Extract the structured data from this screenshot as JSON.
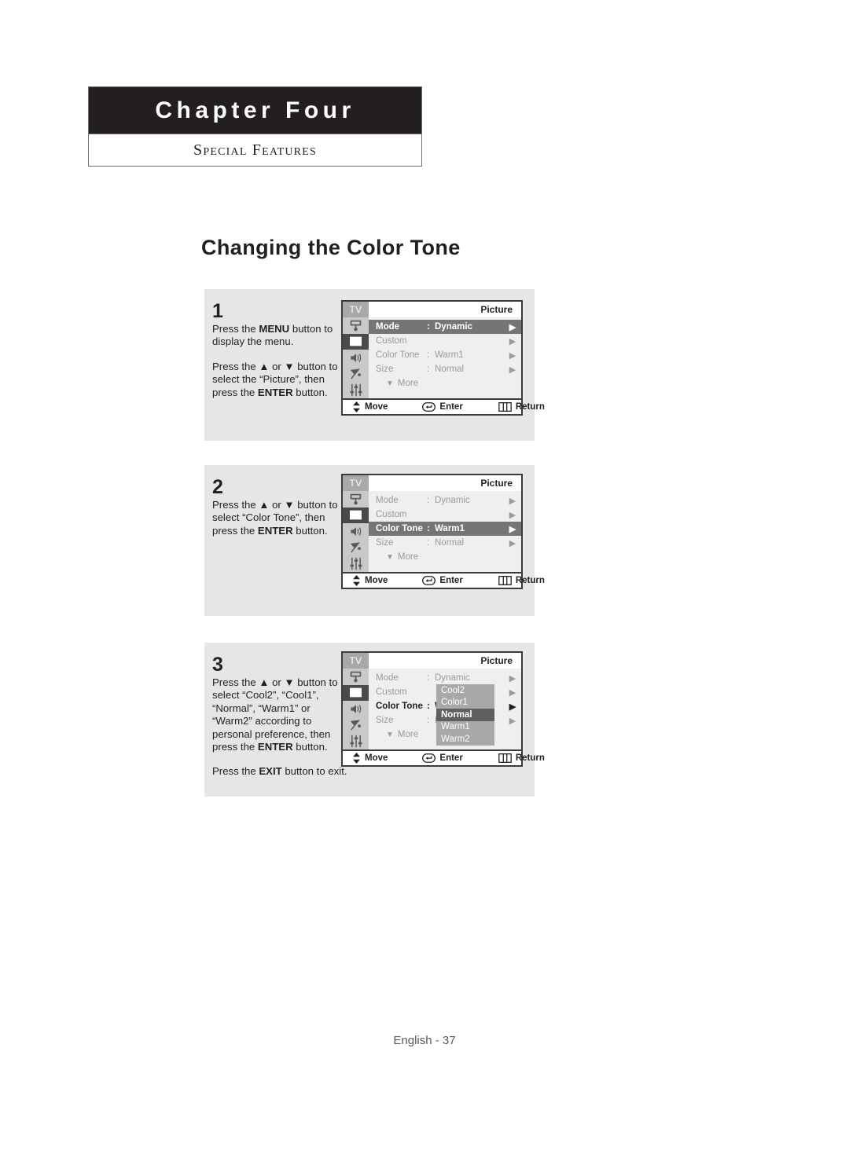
{
  "header": {
    "chapter_title": "Chapter Four",
    "section_title": "Special Features"
  },
  "page_title": "Changing the Color Tone",
  "steps": [
    {
      "number": "1",
      "lines": [
        [
          {
            "t": "Press the ",
            "b": false
          },
          {
            "t": "MENU",
            "b": true
          },
          {
            "t": " button to display the menu.",
            "b": false
          }
        ],
        [
          {
            "t": "Press the ",
            "b": false
          },
          {
            "t": "▲",
            "b": false
          },
          {
            "t": " or ",
            "b": false
          },
          {
            "t": "▼",
            "b": false
          },
          {
            "t": " button to select the “Picture”, then press the ",
            "b": false
          },
          {
            "t": "ENTER",
            "b": true
          },
          {
            "t": " button.",
            "b": false
          }
        ]
      ]
    },
    {
      "number": "2",
      "lines": [
        [
          {
            "t": "Press the ",
            "b": false
          },
          {
            "t": "▲",
            "b": false
          },
          {
            "t": " or ",
            "b": false
          },
          {
            "t": "▼",
            "b": false
          },
          {
            "t": " button to select “Color Tone”, then press the ",
            "b": false
          },
          {
            "t": "ENTER",
            "b": true
          },
          {
            "t": " button.",
            "b": false
          }
        ]
      ]
    },
    {
      "number": "3",
      "lines": [
        [
          {
            "t": "Press the ",
            "b": false
          },
          {
            "t": "▲",
            "b": false
          },
          {
            "t": " or ",
            "b": false
          },
          {
            "t": "▼",
            "b": false
          },
          {
            "t": " button to select “Cool2”, “Cool1”, “Normal”, “Warm1” or “Warm2” according to personal preference, then press the ",
            "b": false
          },
          {
            "t": "ENTER",
            "b": true
          },
          {
            "t": " button.",
            "b": false
          }
        ],
        [
          {
            "t": "Press the ",
            "b": false
          },
          {
            "t": "EXIT",
            "b": true
          },
          {
            "t": " button to exit.",
            "b": false
          }
        ]
      ]
    }
  ],
  "osd": {
    "tv_label": "TV",
    "title": "Picture",
    "more_label": "More",
    "rail_icons": [
      "input-source-icon",
      "picture-icon",
      "sound-icon",
      "channel-satellite-icon",
      "setup-sliders-icon"
    ],
    "rail_active_index": 1,
    "bottom_bar": {
      "move": "Move",
      "enter": "Enter",
      "return": "Return"
    },
    "rows": [
      {
        "label": "Mode",
        "colon": ":",
        "value": "Dynamic",
        "caret": "▶"
      },
      {
        "label": "Custom",
        "colon": "",
        "value": "",
        "caret": "▶"
      },
      {
        "label": "Color Tone",
        "colon": ":",
        "value": "Warm1",
        "caret": "▶"
      },
      {
        "label": "Size",
        "colon": ":",
        "value": "Normal",
        "caret": "▶"
      }
    ],
    "menus": [
      {
        "selected_row": 0
      },
      {
        "selected_row": 2
      },
      {
        "selected_row": -1,
        "bold_row": 2
      }
    ],
    "dropdown": {
      "items": [
        "Cool2",
        "Color1",
        "Normal",
        "Warm1",
        "Warm2"
      ],
      "selected": "Normal"
    }
  },
  "footer": "English - 37",
  "colors": {
    "header_bg": "#231f20",
    "panel_bg": "#e6e6e6",
    "osd_selected": "#757575",
    "osd_rail": "#c9c9c9",
    "osd_rail_active": "#4a4a4a",
    "dropdown_bg": "#a8a8a8",
    "dropdown_selected": "#5f5f5f"
  }
}
